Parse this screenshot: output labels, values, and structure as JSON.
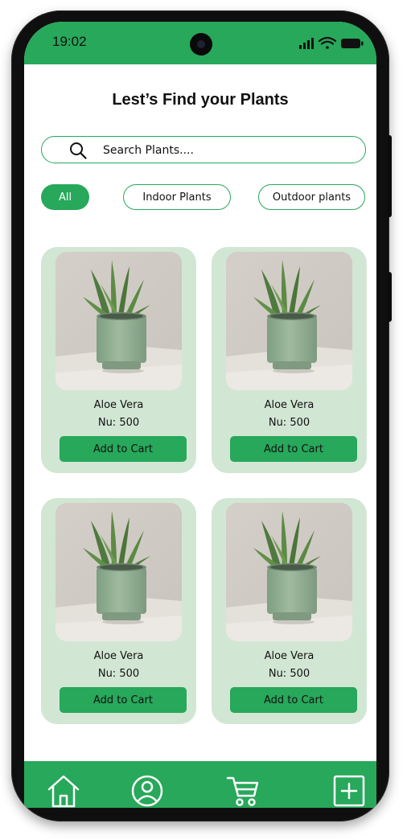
{
  "status_bar": {
    "time": "19:02",
    "icons": [
      "signal-icon",
      "wifi-icon",
      "battery-icon"
    ]
  },
  "header": {
    "title": "Lest’s Find your Plants"
  },
  "search": {
    "placeholder": "Search Plants...."
  },
  "filters": [
    {
      "label": "All",
      "active": true
    },
    {
      "label": "Indoor Plants",
      "active": false
    },
    {
      "label": "Outdoor plants",
      "active": false
    }
  ],
  "products": [
    {
      "name": "Aloe Vera",
      "price": "Nu: 500",
      "button": "Add to Cart"
    },
    {
      "name": "Aloe Vera",
      "price": "Nu: 500",
      "button": "Add to Cart"
    },
    {
      "name": "Aloe Vera",
      "price": "Nu: 500",
      "button": "Add to Cart"
    },
    {
      "name": "Aloe Vera",
      "price": "Nu: 500",
      "button": "Add to Cart"
    }
  ],
  "bottom_nav": [
    {
      "icon": "home-icon"
    },
    {
      "icon": "profile-icon"
    },
    {
      "icon": "cart-icon"
    },
    {
      "icon": "add-icon"
    }
  ],
  "colors": {
    "accent": "#27a85a",
    "card": "#d2e6d4",
    "frame": "#0f0f10"
  }
}
